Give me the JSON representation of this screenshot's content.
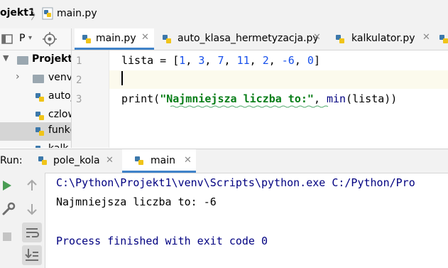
{
  "breadcrumb": {
    "project": "ojekt1",
    "file": "main.py"
  },
  "project_panel": {
    "view_label": "P",
    "tree": [
      {
        "label": "Projekt1",
        "bold": true
      },
      {
        "label": "venv"
      },
      {
        "label": "auto_"
      },
      {
        "label": "czlow"
      },
      {
        "label": "funkc"
      },
      {
        "label": "kalk"
      }
    ]
  },
  "editor": {
    "tabs": [
      {
        "label": "main.py",
        "active": true
      },
      {
        "label": "auto_klasa_hermetyzacja.py",
        "active": false
      },
      {
        "label": "kalkulator.py",
        "active": false
      }
    ],
    "line_numbers": [
      "1",
      "2",
      "3"
    ],
    "line1": {
      "a": "lista = [",
      "n1": "1",
      "c1": ", ",
      "n2": "3",
      "c2": ", ",
      "n3": "7",
      "c3": ", ",
      "n4": "11",
      "c4": ", ",
      "n5": "2",
      "c5": ", ",
      "n6": "-6",
      "c6": ", ",
      "n7": "0",
      "z": "]"
    },
    "line3": {
      "a": "print(",
      "s": "\"Najmniejsza liczba to:\"",
      "b": ", ",
      "f": "min",
      "c": "(lista))"
    }
  },
  "run": {
    "label": "Run:",
    "tabs": [
      {
        "label": "pole_kola",
        "active": false
      },
      {
        "label": "main",
        "active": true
      }
    ],
    "console": [
      "C:\\Python\\Projekt1\\venv\\Scripts\\python.exe C:/Python/Pro",
      "Najmniejsza liczba to: -6",
      "",
      "Process finished with exit code 0"
    ]
  },
  "colors": {
    "accent": "#4083c9",
    "run_green": "#499c54",
    "console_blue": "#000080"
  }
}
